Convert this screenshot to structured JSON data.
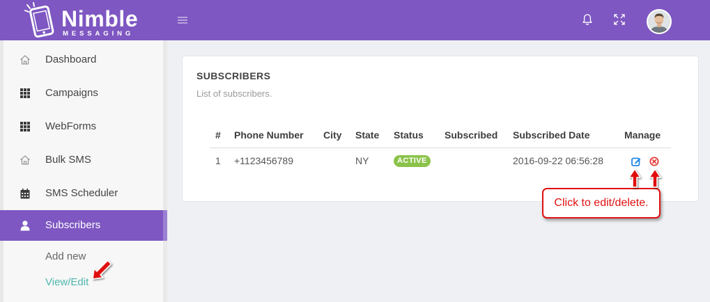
{
  "brand": {
    "name": "Nimble",
    "tagline": "MESSAGING",
    "icon": "phone-logo-icon"
  },
  "header": {
    "icons": {
      "menu": "hamburger-icon",
      "notifications": "bell-icon",
      "fullscreen": "fullscreen-icon",
      "avatar": "user-avatar"
    }
  },
  "sidebar": {
    "items": [
      {
        "label": "Dashboard",
        "icon": "home-icon"
      },
      {
        "label": "Campaigns",
        "icon": "grid-icon"
      },
      {
        "label": "WebForms",
        "icon": "grid-icon"
      },
      {
        "label": "Bulk SMS",
        "icon": "home-icon"
      },
      {
        "label": "SMS Scheduler",
        "icon": "calendar-icon"
      },
      {
        "label": "Subscribers",
        "icon": "user-icon",
        "active": true
      }
    ],
    "submenu": [
      {
        "label": "Add new"
      },
      {
        "label": "View/Edit",
        "active": true
      }
    ]
  },
  "main": {
    "title": "SUBSCRIBERS",
    "subtitle": "List of subscribers.",
    "table": {
      "columns": [
        "#",
        "Phone Number",
        "City",
        "State",
        "Status",
        "Subscribed",
        "Subscribed Date",
        "Manage"
      ],
      "rows": [
        {
          "num": "1",
          "phone": "+1123456789",
          "city": "",
          "state": "NY",
          "status": "ACTIVE",
          "subscribed": "",
          "subscribed_date": "2016-09-22 06:56:28",
          "actions": [
            {
              "icon": "edit-icon"
            },
            {
              "icon": "delete-icon"
            }
          ]
        }
      ]
    }
  },
  "annotation": {
    "callout": "Click to edit/delete."
  },
  "theme": {
    "primary": "#7e57c2",
    "primary_light": "#9c80d3",
    "status_active": "#8bc34a",
    "submenu_active": "#4db6ac",
    "annotation": "#e01010",
    "edit": "#1e88e5",
    "delete": "#e53935"
  }
}
